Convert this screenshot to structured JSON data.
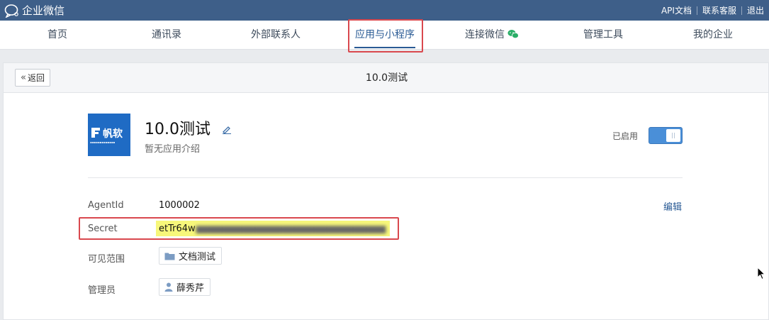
{
  "topbar": {
    "logo_text": "企业微信",
    "links": [
      "API文档",
      "联系客服",
      "退出"
    ]
  },
  "nav": {
    "items": [
      {
        "label": "首页"
      },
      {
        "label": "通讯录"
      },
      {
        "label": "外部联系人"
      },
      {
        "label": "应用与小程序",
        "active": true
      },
      {
        "label": "连接微信"
      },
      {
        "label": "管理工具"
      },
      {
        "label": "我的企业"
      }
    ]
  },
  "panel": {
    "back_label": "返回",
    "title": "10.0测试"
  },
  "app": {
    "logo_brand": "帆软",
    "name": "10.0测试",
    "description": "暂无应用介绍",
    "status_label": "已启用",
    "enabled": true
  },
  "fields": {
    "agentid_label": "AgentId",
    "agentid_value": "1000002",
    "edit_label": "编辑",
    "secret_label": "Secret",
    "secret_visible": "etTr64w",
    "visibility_label": "可见范围",
    "visibility_value": "文档测试",
    "admin_label": "管理员",
    "admin_value": "薛秀芹"
  },
  "colors": {
    "topbar": "#3e5f89",
    "accent": "#2a5b95",
    "highlight_box": "#d9484e",
    "secret_highlight": "#f7f77a",
    "toggle_on": "#4a8fd8"
  }
}
